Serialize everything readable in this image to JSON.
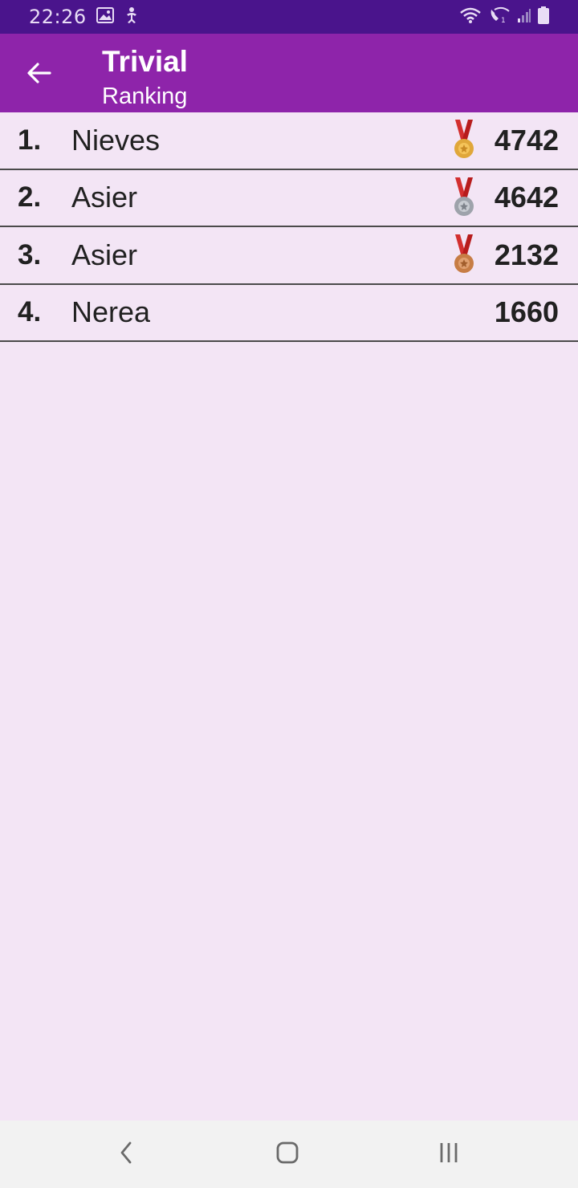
{
  "status_bar": {
    "time": "22:26",
    "icons": [
      "image-icon",
      "accessibility-icon",
      "wifi-icon",
      "wifi-calling-icon",
      "signal-icon",
      "battery-icon"
    ]
  },
  "app_bar": {
    "title": "Trivial",
    "subtitle": "Ranking",
    "background": "#8e24aa"
  },
  "ranking": [
    {
      "position": "1.",
      "name": "Nieves",
      "score": "4742",
      "medal": "gold"
    },
    {
      "position": "2.",
      "name": "Asier",
      "score": "4642",
      "medal": "silver"
    },
    {
      "position": "3.",
      "name": "Asier",
      "score": "2132",
      "medal": "bronze"
    },
    {
      "position": "4.",
      "name": "Nerea",
      "score": "1660",
      "medal": ""
    }
  ],
  "colors": {
    "status_bar": "#4a148c",
    "background": "#f3e5f5",
    "gold": "#e0a73a",
    "silver": "#9ea3ab",
    "bronze": "#c77d45",
    "ribbon": "#d32f2f"
  }
}
